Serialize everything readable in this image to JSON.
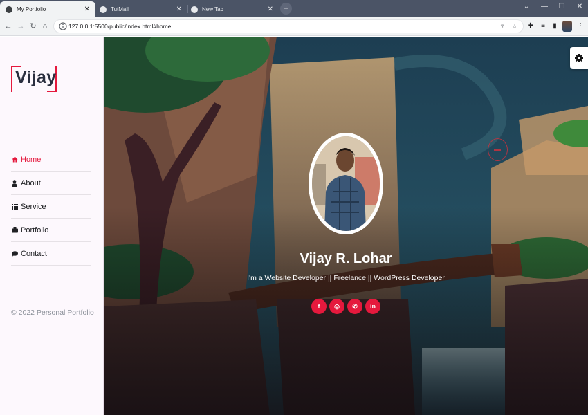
{
  "browser": {
    "tabs": [
      {
        "title": "My Portfolio",
        "active": true
      },
      {
        "title": "TutMall",
        "active": false
      },
      {
        "title": "New Tab",
        "active": false
      }
    ],
    "url": "127.0.0.1:5500/public/index.html#home",
    "icons": [
      "back-icon",
      "forward-icon",
      "reload-icon",
      "home-icon",
      "share-icon",
      "bookmark-star-icon",
      "extensions-icon",
      "reading-list-icon",
      "side-panel-icon",
      "profile-icon",
      "menu-icon"
    ]
  },
  "sidebar": {
    "logo": "Vijay",
    "nav": [
      {
        "label": "Home",
        "icon": "home-icon"
      },
      {
        "label": "About",
        "icon": "user-icon"
      },
      {
        "label": "Service",
        "icon": "list-icon"
      },
      {
        "label": "Portfolio",
        "icon": "briefcase-icon"
      },
      {
        "label": "Contact",
        "icon": "comments-icon"
      }
    ],
    "copyright": "© 2022 Personal Portfolio"
  },
  "hero": {
    "name": "Vijay R. Lohar",
    "tagline": "I'm a Website Developer || Freelance || WordPress Developer",
    "socials": [
      {
        "label": "f",
        "icon": "facebook-icon"
      },
      {
        "label": "◎",
        "icon": "instagram-icon"
      },
      {
        "label": "✆",
        "icon": "whatsapp-icon"
      },
      {
        "label": "in",
        "icon": "linkedin-icon"
      }
    ]
  },
  "colors": {
    "accent": "#e5193d",
    "sidebar_bg": "#fdf8fd",
    "chrome_dark": "#4b5466"
  }
}
